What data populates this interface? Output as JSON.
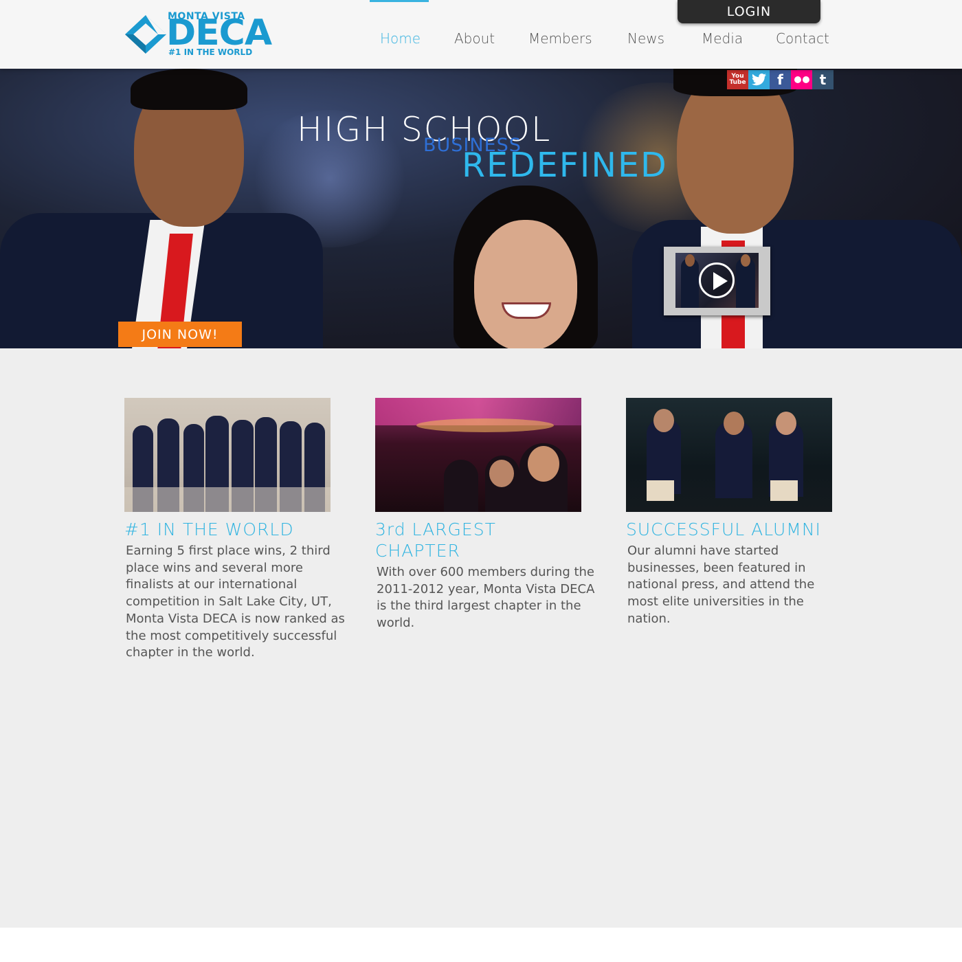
{
  "brand": {
    "top": "MONTA VISTA",
    "name": "DECA",
    "tagline": "#1 IN THE WORLD",
    "color": "#1b9ad0"
  },
  "header": {
    "login_label": "LOGIN",
    "nav": [
      {
        "label": "Home",
        "active": true
      },
      {
        "label": "About"
      },
      {
        "label": "Members"
      },
      {
        "label": "News"
      },
      {
        "label": "Media"
      },
      {
        "label": "Contact"
      }
    ]
  },
  "hero": {
    "line1": "HIGH SCHOOL",
    "line2": "BUSINESS",
    "line3": "REDEFINED",
    "join_label": "JOIN NOW!",
    "social": [
      {
        "icon": "youtube-icon",
        "glyph": "You\nTube"
      },
      {
        "icon": "twitter-icon",
        "glyph": "🐦"
      },
      {
        "icon": "facebook-icon",
        "glyph": "f"
      },
      {
        "icon": "flickr-icon",
        "glyph": "●●"
      },
      {
        "icon": "tumblr-icon",
        "glyph": "t"
      }
    ]
  },
  "features": [
    {
      "title": "#1 IN THE WORLD",
      "text": "Earning 5 first place wins, 2 third place wins and several more finalists at our international competition in Salt Lake City, UT, Monta Vista DECA is now ranked as the most competitively successful chapter in the world."
    },
    {
      "title": "3rd LARGEST CHAPTER",
      "text": "With over 600 members during the 2011-2012 year, Monta Vista DECA is the third largest chapter in the world."
    },
    {
      "title": "SUCCESSFUL ALUMNI",
      "text": "Our alumni have started businesses, been featured in national press, and attend the most elite universities in the nation."
    }
  ],
  "colors": {
    "accent": "#3ab3e0",
    "join": "#f47b16",
    "login_bg": "#2b2b2b",
    "content_bg": "#eeeeee"
  }
}
